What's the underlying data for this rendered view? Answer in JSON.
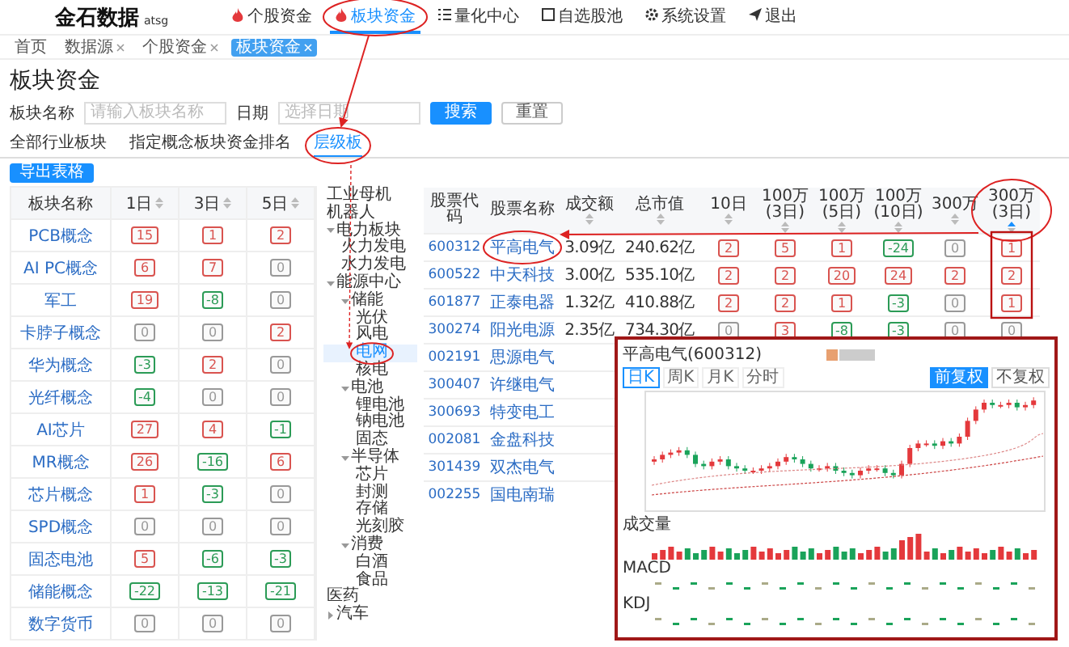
{
  "header": {
    "logo": "金石数据",
    "logo_sub": "atsg",
    "nav": [
      {
        "label": "个股资金",
        "selected": false
      },
      {
        "label": "板块资金",
        "selected": true
      },
      {
        "label": "量化中心",
        "selected": false
      },
      {
        "label": "自选股池",
        "selected": false
      },
      {
        "label": "系统设置",
        "selected": false
      },
      {
        "label": "退出",
        "selected": false
      }
    ]
  },
  "breadcrumbs": [
    {
      "label": "首页",
      "selected": false,
      "closable": false
    },
    {
      "label": "数据源",
      "selected": false,
      "closable": true
    },
    {
      "label": "个股资金",
      "selected": false,
      "closable": true
    },
    {
      "label": "板块资金",
      "selected": true,
      "closable": true
    }
  ],
  "page_title": "板块资金",
  "filters": [
    {
      "label": "板块名称",
      "placeholder": "请输入板块名称"
    },
    {
      "label": "日期",
      "placeholder": "选择日期"
    }
  ],
  "buttons": [
    {
      "label": "搜索",
      "kind": "primary"
    },
    {
      "label": "重置",
      "kind": "plain"
    }
  ],
  "tabs": [
    {
      "label": "全部行业板块",
      "selected": false
    },
    {
      "label": "指定概念板块资金排名",
      "selected": false
    },
    {
      "label": "层级板",
      "selected": true
    }
  ],
  "export_button": "导出表格",
  "sector_table": {
    "columns": [
      "板块名称",
      "1日",
      "3日",
      "5日"
    ],
    "rows": [
      {
        "name": "PCB概念",
        "ranks": [
          {
            "text": "15",
            "color": "#d9534f"
          },
          {
            "text": "1",
            "color": "#d9534f"
          },
          {
            "text": "2",
            "color": "#d9534f"
          }
        ]
      },
      {
        "name": "AI PC概念",
        "ranks": [
          {
            "text": "6",
            "color": "#d9534f"
          },
          {
            "text": "7",
            "color": "#d9534f"
          },
          {
            "text": "0",
            "color": "#999999"
          }
        ]
      },
      {
        "name": "军工",
        "ranks": [
          {
            "text": "19",
            "color": "#d9534f"
          },
          {
            "text": "-8",
            "color": "#2b9b56"
          },
          {
            "text": "0",
            "color": "#999999"
          }
        ]
      },
      {
        "name": "卡脖子概念",
        "ranks": [
          {
            "text": "0",
            "color": "#999999"
          },
          {
            "text": "0",
            "color": "#999999"
          },
          {
            "text": "2",
            "color": "#d9534f"
          }
        ]
      },
      {
        "name": "华为概念",
        "ranks": [
          {
            "text": "-3",
            "color": "#2b9b56"
          },
          {
            "text": "2",
            "color": "#d9534f"
          },
          {
            "text": "0",
            "color": "#999999"
          }
        ]
      },
      {
        "name": "光纤概念",
        "ranks": [
          {
            "text": "-4",
            "color": "#2b9b56"
          },
          {
            "text": "0",
            "color": "#999999"
          },
          {
            "text": "0",
            "color": "#999999"
          }
        ]
      },
      {
        "name": "AI芯片",
        "ranks": [
          {
            "text": "27",
            "color": "#d9534f"
          },
          {
            "text": "4",
            "color": "#d9534f"
          },
          {
            "text": "-1",
            "color": "#2b9b56"
          }
        ]
      },
      {
        "name": "MR概念",
        "ranks": [
          {
            "text": "26",
            "color": "#d9534f"
          },
          {
            "text": "-16",
            "color": "#2b9b56"
          },
          {
            "text": "6",
            "color": "#d9534f"
          }
        ]
      },
      {
        "name": "芯片概念",
        "ranks": [
          {
            "text": "1",
            "color": "#d9534f"
          },
          {
            "text": "-3",
            "color": "#2b9b56"
          },
          {
            "text": "0",
            "color": "#999999"
          }
        ]
      },
      {
        "name": "SPD概念",
        "ranks": [
          {
            "text": "0",
            "color": "#999999"
          },
          {
            "text": "0",
            "color": "#999999"
          },
          {
            "text": "0",
            "color": "#999999"
          }
        ]
      },
      {
        "name": "固态电池",
        "ranks": [
          {
            "text": "5",
            "color": "#d9534f"
          },
          {
            "text": "-6",
            "color": "#2b9b56"
          },
          {
            "text": "-3",
            "color": "#2b9b56"
          }
        ]
      },
      {
        "name": "储能概念",
        "ranks": [
          {
            "text": "-22",
            "color": "#2b9b56"
          },
          {
            "text": "-13",
            "color": "#2b9b56"
          },
          {
            "text": "-21",
            "color": "#2b9b56"
          }
        ]
      },
      {
        "name": "数字货币",
        "ranks": [
          {
            "text": "0",
            "color": "#999999"
          },
          {
            "text": "0",
            "color": "#999999"
          },
          {
            "text": "0",
            "color": "#999999"
          }
        ]
      }
    ]
  },
  "tree": [
    {
      "label": "工业母机",
      "selected": false
    },
    {
      "label": "机器人",
      "selected": false
    },
    {
      "label": "电力板块",
      "expanded": true,
      "selected": false,
      "children": [
        {
          "label": "火力发电",
          "selected": false
        },
        {
          "label": "水力发电",
          "selected": false
        }
      ]
    },
    {
      "label": "能源中心",
      "expanded": true,
      "selected": false,
      "children": [
        {
          "label": "储能",
          "expanded": true,
          "selected": false,
          "children": [
            {
              "label": "光伏",
              "selected": false
            },
            {
              "label": "风电",
              "selected": false
            },
            {
              "label": "电网",
              "selected": true
            },
            {
              "label": "核电",
              "selected": false
            }
          ]
        },
        {
          "label": "电池",
          "expanded": true,
          "selected": false,
          "children": [
            {
              "label": "锂电池",
              "selected": false
            },
            {
              "label": "钠电池",
              "selected": false
            },
            {
              "label": "固态",
              "selected": false
            }
          ]
        },
        {
          "label": "半导体",
          "expanded": true,
          "selected": false,
          "children": [
            {
              "label": "芯片",
              "selected": false
            },
            {
              "label": "封测",
              "selected": false
            },
            {
              "label": "存储",
              "selected": false
            },
            {
              "label": "光刻胶",
              "selected": false
            }
          ]
        },
        {
          "label": "消费",
          "expanded": true,
          "selected": false,
          "children": [
            {
              "label": "白酒",
              "selected": false
            },
            {
              "label": "食品",
              "selected": false
            }
          ]
        }
      ]
    },
    {
      "label": "医药",
      "selected": false
    },
    {
      "label": "汽车",
      "expanded": false,
      "selected": false
    }
  ],
  "stock_table": {
    "columns": [
      "股票代码",
      "股票名称",
      "成交额",
      "总市值",
      "10日",
      "100万(3日)",
      "100万(5日)",
      "100万(10日)",
      "300万",
      "300万(3日)"
    ],
    "rows": [
      {
        "code": "600312",
        "name": "平高电气",
        "turnover": "3.09亿",
        "cap": "240.62亿",
        "ranks": [
          {
            "text": "2",
            "color": "#d9534f"
          },
          {
            "text": "5",
            "color": "#d9534f"
          },
          {
            "text": "1",
            "color": "#d9534f"
          },
          {
            "text": "-24",
            "color": "#2b9b56"
          },
          {
            "text": "0",
            "color": "#999999"
          },
          {
            "text": "1",
            "color": "#d9534f"
          }
        ]
      },
      {
        "code": "600522",
        "name": "中天科技",
        "turnover": "3.00亿",
        "cap": "535.10亿",
        "ranks": [
          {
            "text": "2",
            "color": "#d9534f"
          },
          {
            "text": "2",
            "color": "#d9534f"
          },
          {
            "text": "20",
            "color": "#d9534f"
          },
          {
            "text": "24",
            "color": "#d9534f"
          },
          {
            "text": "2",
            "color": "#d9534f"
          },
          {
            "text": "2",
            "color": "#d9534f"
          }
        ]
      },
      {
        "code": "601877",
        "name": "正泰电器",
        "turnover": "1.32亿",
        "cap": "410.88亿",
        "ranks": [
          {
            "text": "2",
            "color": "#d9534f"
          },
          {
            "text": "2",
            "color": "#d9534f"
          },
          {
            "text": "1",
            "color": "#d9534f"
          },
          {
            "text": "-3",
            "color": "#2b9b56"
          },
          {
            "text": "0",
            "color": "#999999"
          },
          {
            "text": "1",
            "color": "#d9534f"
          }
        ]
      },
      {
        "code": "300274",
        "name": "阳光电源",
        "turnover": "2.35亿",
        "cap": "734.30亿",
        "ranks": [
          {
            "text": "0",
            "color": "#999999"
          },
          {
            "text": "3",
            "color": "#d9534f"
          },
          {
            "text": "-8",
            "color": "#2b9b56"
          },
          {
            "text": "-3",
            "color": "#2b9b56"
          },
          {
            "text": "0",
            "color": "#999999"
          },
          {
            "text": "0",
            "color": "#999999"
          }
        ]
      },
      {
        "code": "002191",
        "name": "思源电气"
      },
      {
        "code": "300407",
        "name": "许继电气"
      },
      {
        "code": "300693",
        "name": "特变电工"
      },
      {
        "code": "002081",
        "name": "金盘科技"
      },
      {
        "code": "301439",
        "name": "双杰电气"
      },
      {
        "code": "002255",
        "name": "国电南瑞"
      }
    ]
  },
  "chart_popup": {
    "title": "平高电气(600312)",
    "periods": [
      {
        "label": "日K",
        "selected": true
      },
      {
        "label": "周K",
        "selected": false
      },
      {
        "label": "月K",
        "selected": false
      },
      {
        "label": "分时",
        "selected": false
      }
    ],
    "adjust": [
      {
        "label": "前复权",
        "selected": true
      },
      {
        "label": "不复权",
        "selected": false
      }
    ],
    "panes": [
      "成交量",
      "MACD",
      "KDJ"
    ]
  }
}
